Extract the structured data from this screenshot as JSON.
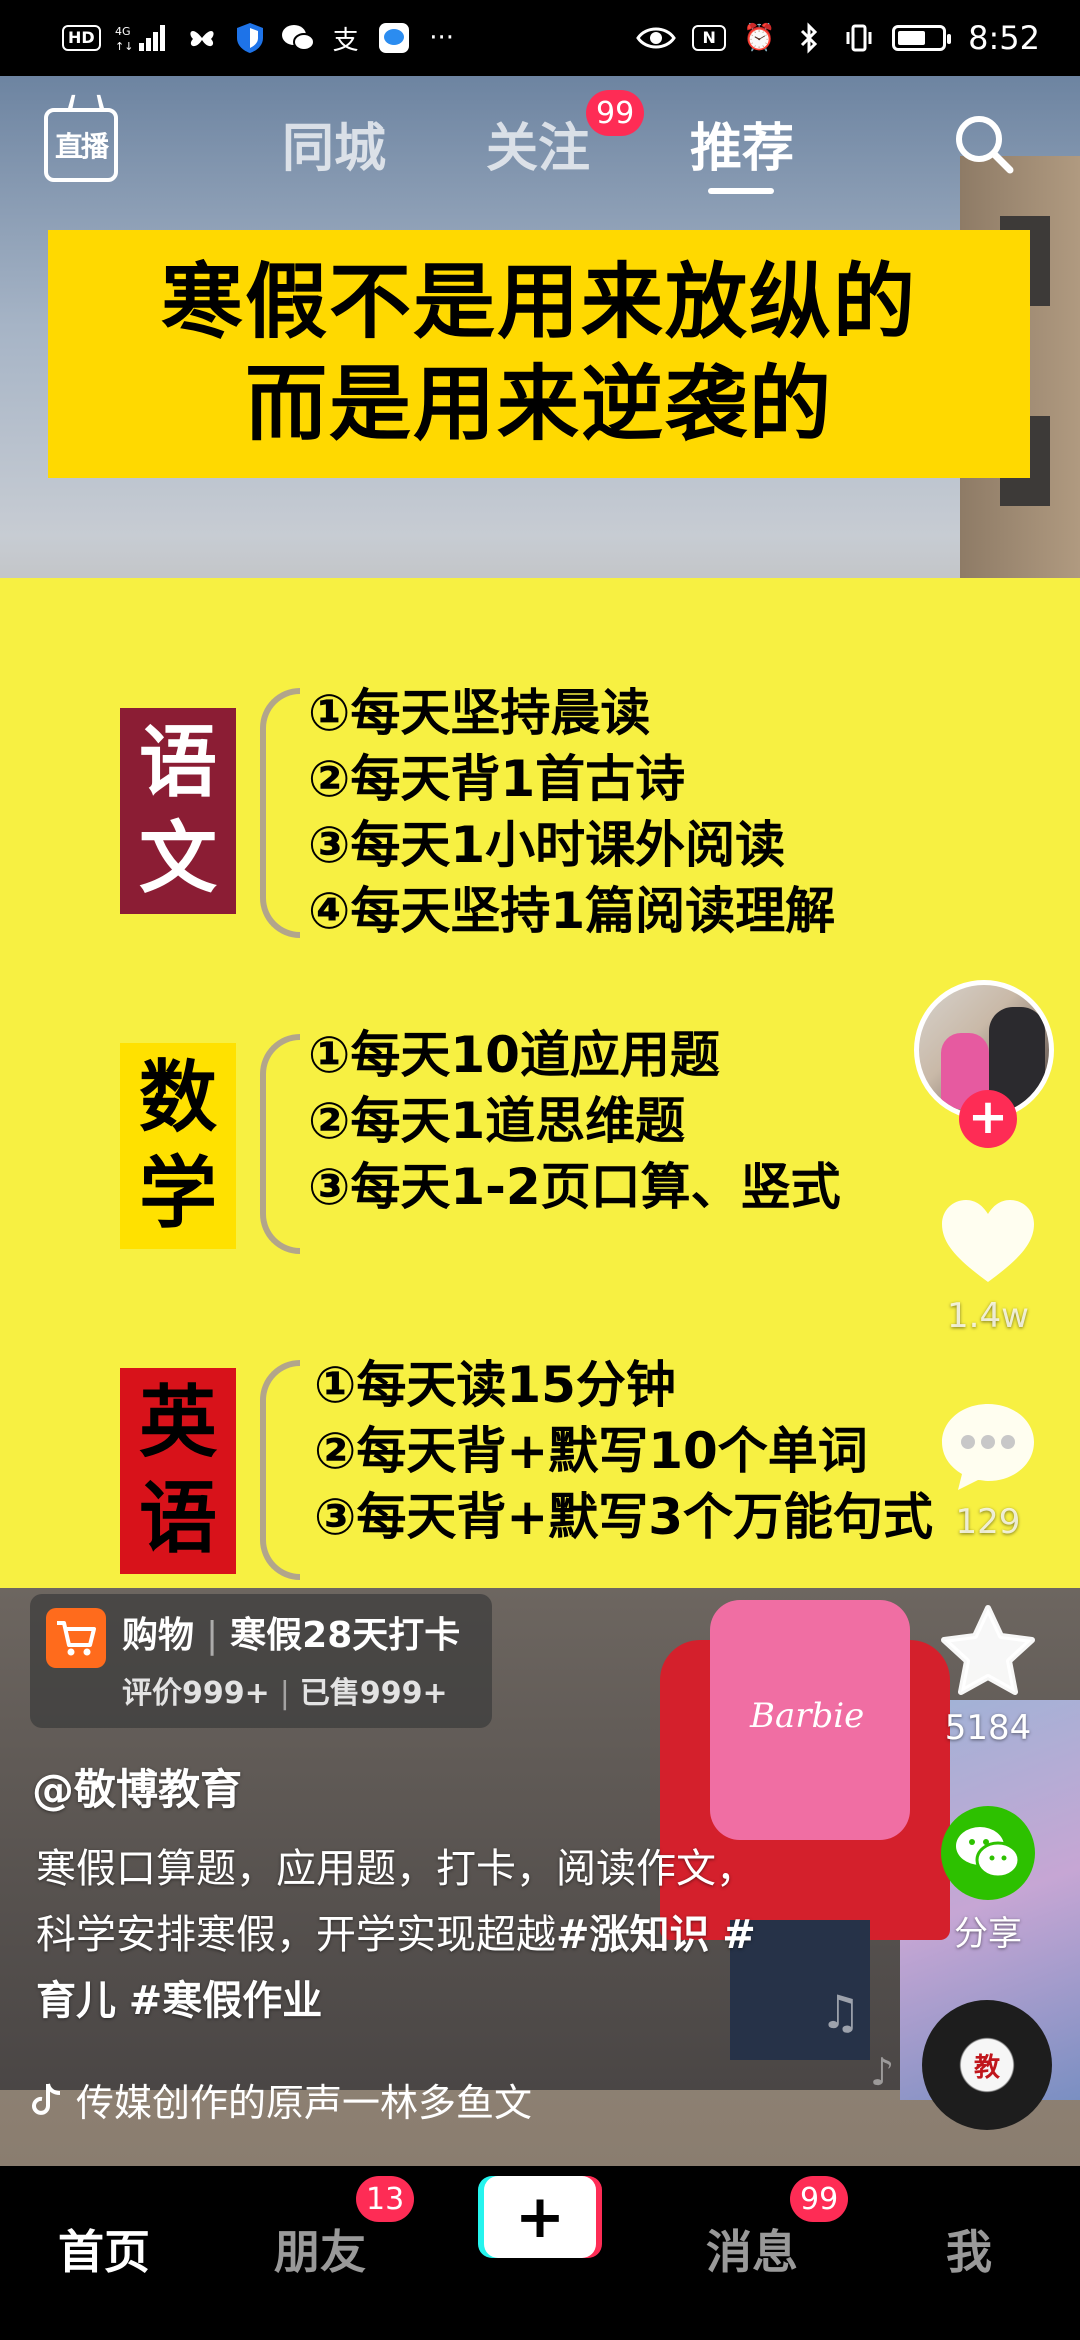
{
  "status_bar": {
    "hd": "HD",
    "signal": "4G",
    "time": "8:52"
  },
  "top_nav": {
    "live_label": "直播",
    "tabs": [
      {
        "label": "同城"
      },
      {
        "label": "关注",
        "badge": "99"
      },
      {
        "label": "推荐",
        "active": true
      }
    ]
  },
  "video": {
    "title_lines": [
      "寒假不是用来放纵的",
      "而是用来逆袭的"
    ],
    "subjects": [
      {
        "name_chars": [
          "语",
          "文"
        ],
        "items": [
          "①每天坚持晨读",
          "②每天背1首古诗",
          "③每天1小时课外阅读",
          "④每天坚持1篇阅读理解"
        ]
      },
      {
        "name_chars": [
          "数",
          "学"
        ],
        "items": [
          "①每天10道应用题",
          "②每天1道思维题",
          "③每天1-2页口算、竖式"
        ]
      },
      {
        "name_chars": [
          "英",
          "语"
        ],
        "items": [
          "①每天读15分钟",
          "②每天背+默写10个单词",
          "③每天背+默写3个万能句式"
        ]
      }
    ],
    "bag_logo": "Barbie"
  },
  "right_rail": {
    "like_count": "1.4w",
    "comment_count": "129",
    "favorite_count": "5184",
    "share_label": "分享",
    "disc_label": "教"
  },
  "shop_card": {
    "type": "购物",
    "product": "寒假28天打卡",
    "rating": "评价999+",
    "sold": "已售999+"
  },
  "caption": {
    "author": "@敬博教育",
    "text": "寒假口算题，应用题，打卡，阅读作文，科学安排寒假，开学实现超越",
    "tags": [
      "#涨知识",
      "#育儿",
      "#寒假作业"
    ],
    "music": "传媒创作的原声一林多鱼文"
  },
  "bottom_nav": {
    "home": "首页",
    "friends": "朋友",
    "friends_badge": "13",
    "messages": "消息",
    "messages_badge": "99",
    "me": "我"
  },
  "colors": {
    "accent_red": "#fe2c55",
    "cyan": "#25f4ee",
    "banner_yellow": "#ffd900",
    "board_yellow": "#f7f042",
    "wechat_green": "#2dc100"
  }
}
